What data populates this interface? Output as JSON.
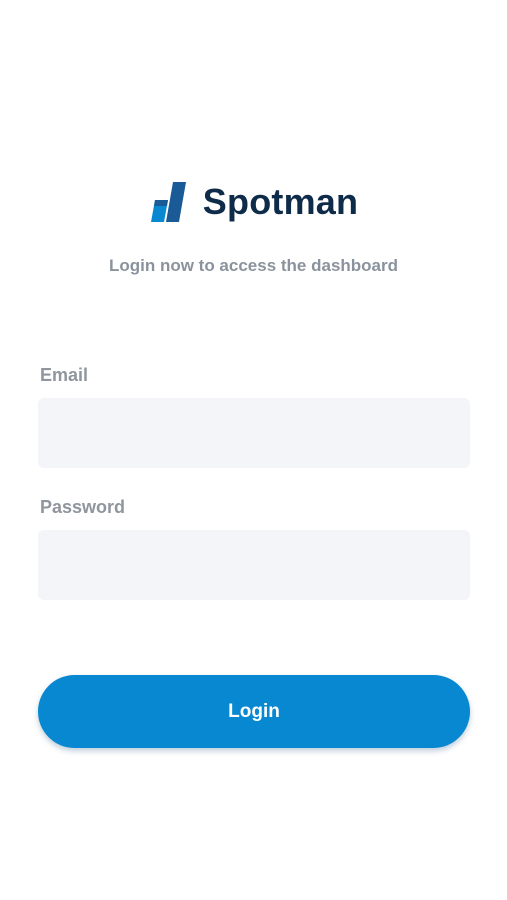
{
  "brand": {
    "name": "Spotman",
    "logo_icon": "spotman-logo-icon"
  },
  "subtitle": "Login now to access the dashboard",
  "form": {
    "email_label": "Email",
    "email_value": "",
    "email_placeholder": "",
    "password_label": "Password",
    "password_value": "",
    "password_placeholder": "",
    "login_label": "Login"
  },
  "colors": {
    "brand_dark": "#0f2b4a",
    "brand_blue": "#0788d1",
    "input_background": "#f3f5f8",
    "label_gray": "#8f969e"
  }
}
